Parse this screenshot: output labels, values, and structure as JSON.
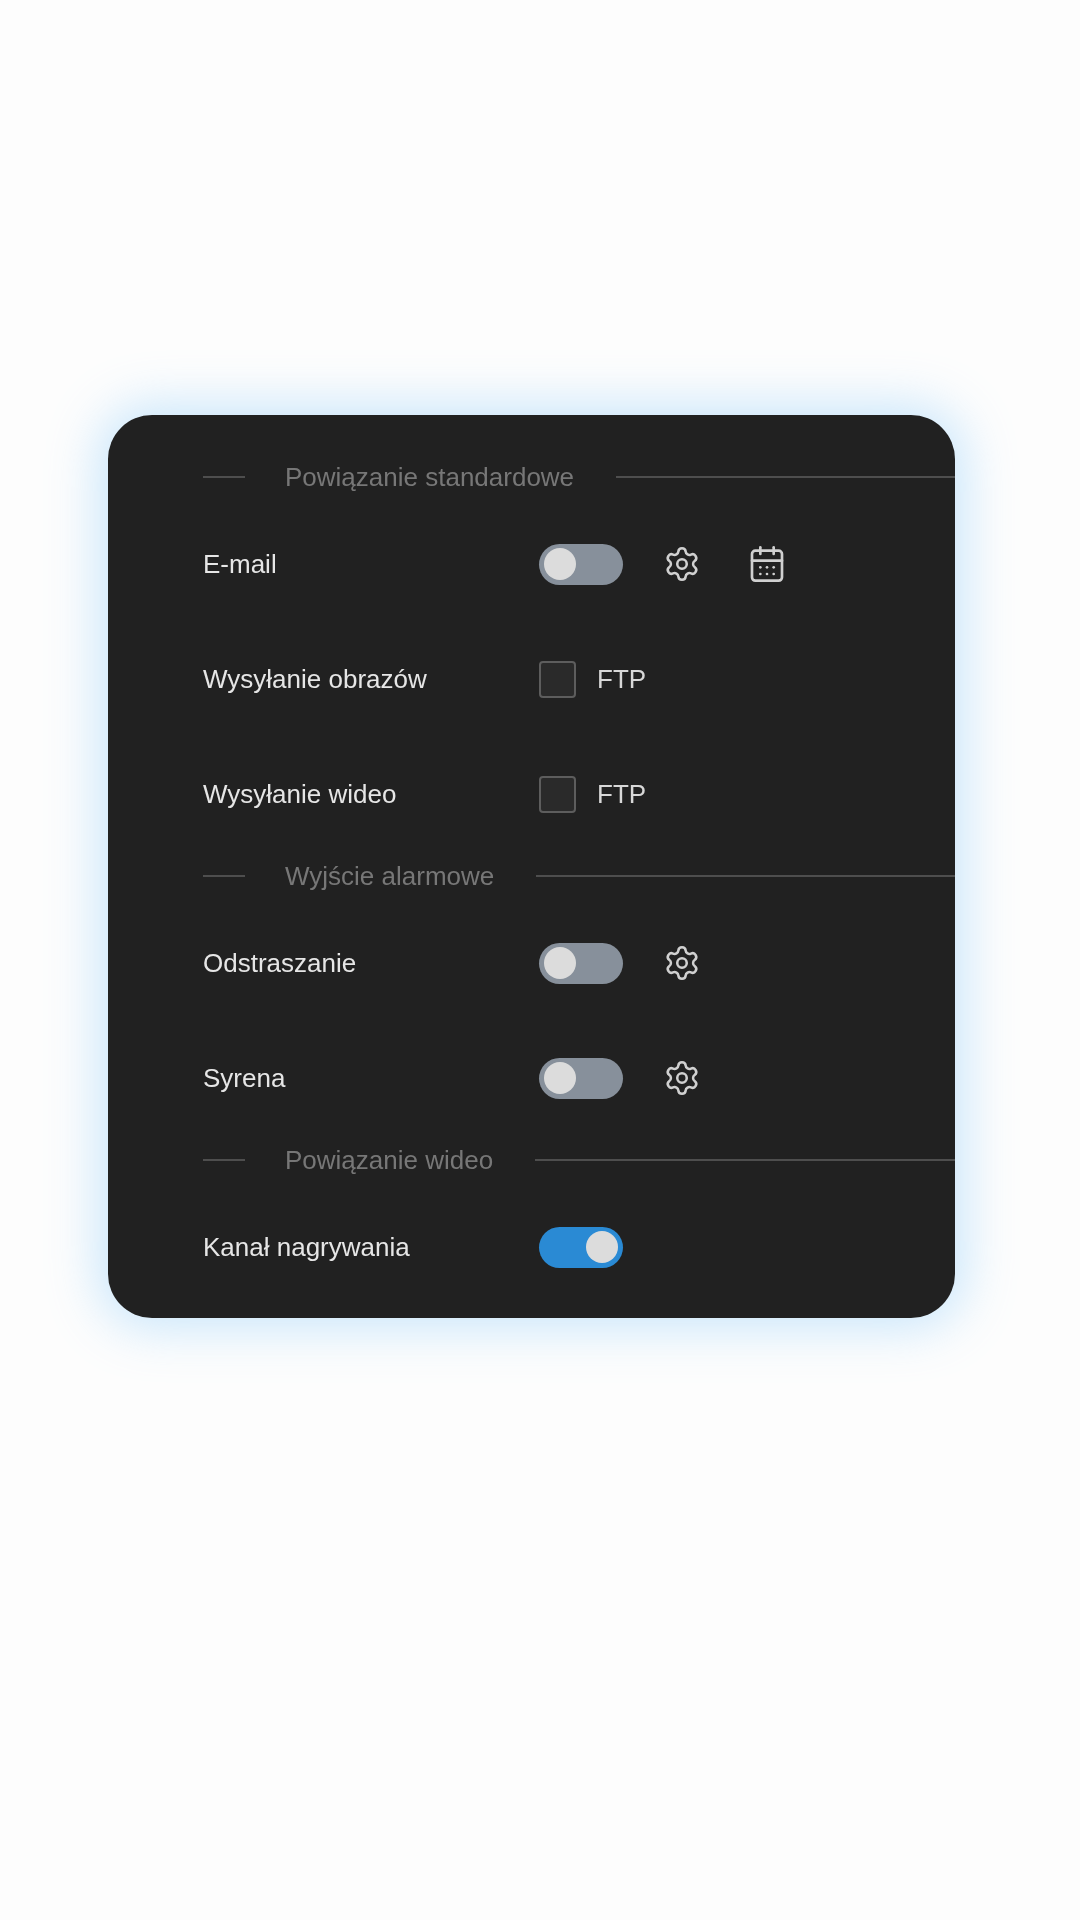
{
  "sections": [
    {
      "title": "Powiązanie standardowe",
      "rows": [
        {
          "label": "E-mail",
          "kind": "toggle",
          "on": false,
          "settings": true,
          "schedule": true
        },
        {
          "label": "Wysyłanie obrazów",
          "kind": "checkbox",
          "checked": false,
          "option": "FTP"
        },
        {
          "label": "Wysyłanie wideo",
          "kind": "checkbox",
          "checked": false,
          "option": "FTP"
        }
      ]
    },
    {
      "title": "Wyjście alarmowe",
      "rows": [
        {
          "label": "Odstraszanie",
          "kind": "toggle",
          "on": false,
          "settings": true,
          "schedule": false
        },
        {
          "label": "Syrena",
          "kind": "toggle",
          "on": false,
          "settings": true,
          "schedule": false
        }
      ]
    },
    {
      "title": "Powiązanie wideo",
      "rows": [
        {
          "label": "Kanał nagrywania",
          "kind": "toggle",
          "on": true,
          "settings": false,
          "schedule": false
        }
      ]
    }
  ]
}
